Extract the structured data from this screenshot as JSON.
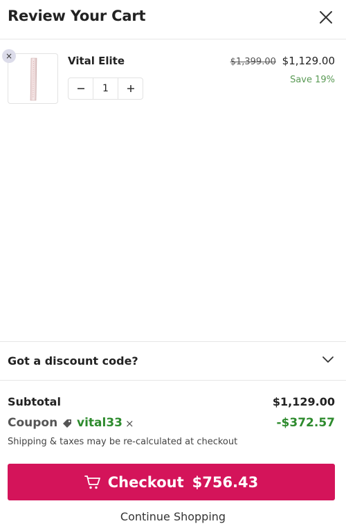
{
  "header": {
    "title": "Review Your Cart",
    "close_icon": "close-icon"
  },
  "cart": {
    "items": [
      {
        "name": "Vital Elite",
        "quantity": "1",
        "original_price": "$1,399.00",
        "price": "$1,129.00",
        "savings": "Save 19%",
        "remove_icon": "close-icon",
        "minus_icon": "minus-icon",
        "plus_icon": "plus-icon"
      }
    ]
  },
  "discount": {
    "label": "Got a discount code?",
    "icon": "chevron-down-icon"
  },
  "summary": {
    "subtotal_label": "Subtotal",
    "subtotal_value": "$1,129.00",
    "coupon_label": "Coupon",
    "coupon_code": "vital33",
    "coupon_remove": "×",
    "coupon_value": "-$372.57",
    "note": "Shipping & taxes may be re-calculated at checkout"
  },
  "checkout": {
    "label": "Checkout",
    "total": "$756.43",
    "icon": "cart-icon"
  },
  "continue_label": "Continue Shopping",
  "colors": {
    "accent": "#d4145a",
    "coupon_green": "#2e8b2e",
    "save_green": "#5a9a55"
  }
}
